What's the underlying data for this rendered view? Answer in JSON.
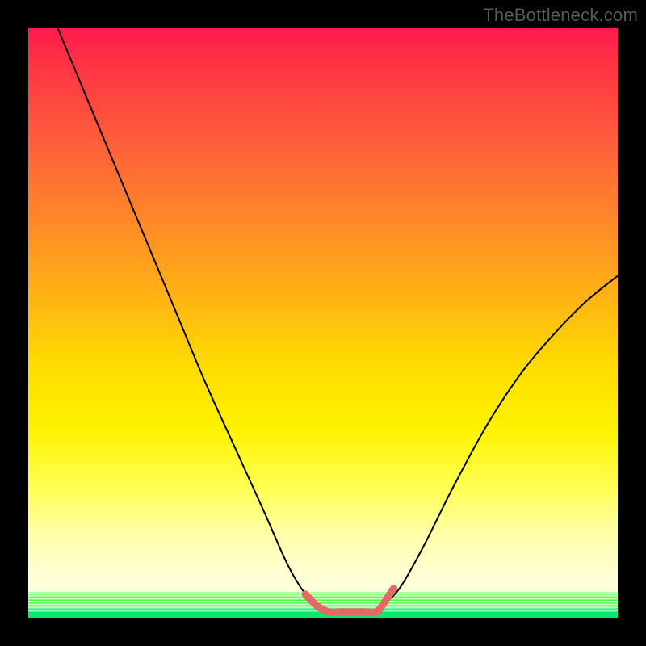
{
  "watermark": "TheBottleneck.com",
  "chart_data": {
    "type": "line",
    "title": "",
    "xlabel": "",
    "ylabel": "",
    "xlim": [
      0,
      100
    ],
    "ylim": [
      0,
      100
    ],
    "grid": false,
    "legend": false,
    "series": [
      {
        "name": "left-curve",
        "stroke": "#000000",
        "x": [
          5,
          10,
          15,
          20,
          25,
          30,
          35,
          40,
          44,
          47,
          49
        ],
        "y": [
          100,
          88,
          76,
          64,
          52,
          40,
          29,
          18,
          9,
          4,
          2
        ]
      },
      {
        "name": "right-curve",
        "stroke": "#000000",
        "x": [
          60,
          63,
          67,
          72,
          78,
          84,
          90,
          95,
          100
        ],
        "y": [
          2,
          5,
          12,
          22,
          33,
          42,
          49,
          54,
          58
        ]
      },
      {
        "name": "marker-band",
        "stroke": "#e36a63",
        "x": [
          47,
          49,
          51,
          53,
          55,
          57,
          59,
          60,
          62
        ],
        "y": [
          4,
          2,
          1,
          1,
          1,
          1,
          1,
          2,
          5
        ]
      }
    ]
  }
}
